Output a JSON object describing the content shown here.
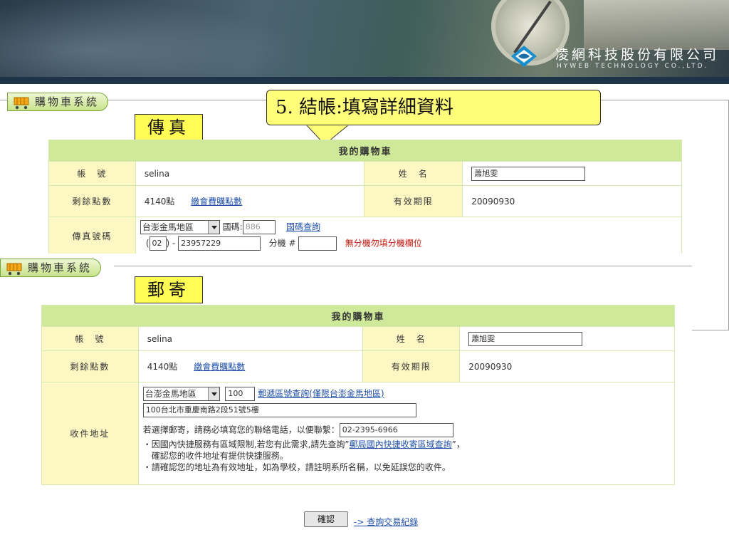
{
  "header": {
    "company_cn": "凌網科技股份有限公司",
    "company_en": "HYWEB TECHNOLOGY CO.,LTD."
  },
  "callout": {
    "text": "5. 結帳:填寫詳細資料"
  },
  "fax_panel": {
    "tab_label": "購物車系統",
    "section_label": "傳真",
    "table_title": "我的購物車",
    "account_label": "帳　號",
    "account_value": "selina",
    "name_label": "姓　名",
    "name_value": "蕭旭雯",
    "points_label": "剩餘點數",
    "points_value": "4140點",
    "pay_link": "繳會費購點數",
    "expiry_label": "有效期限",
    "expiry_value": "20090930",
    "fax_label": "傳真號碼",
    "region_select": "台澎金馬地區",
    "country_code_label": "國碼:",
    "country_code_value": "886",
    "country_lookup_link": "國碼查詢",
    "area_code": "02",
    "fax_number": "23957229",
    "ext_label": "分機 #",
    "ext_note": "無分機勿填分機欄位"
  },
  "mail_panel": {
    "tab_label": "購物車系統",
    "section_label": "郵寄",
    "table_title": "我的購物車",
    "account_label": "帳　號",
    "account_value": "selina",
    "name_label": "姓　名",
    "name_value": "蕭旭雯",
    "points_label": "剩餘點數",
    "points_value": "4140點",
    "pay_link": "繳會費購點數",
    "expiry_label": "有效期限",
    "expiry_value": "20090930",
    "address_label": "收件地址",
    "region_select": "台澎金馬地區",
    "zip_value": "100",
    "zip_lookup_link": "郵遞區號查詢(僅限台澎金馬地區)",
    "address_value": "100台北市重慶南路2段51號5樓",
    "phone_prompt": "若選擇郵寄，請務必填寫您的聯絡電話，以便聯繫：",
    "phone_value": "02-2395-6966",
    "note1_prefix": "・因國內快捷服務有區域限制,若您有此需求,請先查詢”",
    "note1_link": "郵局國內快捷收寄區域查詢",
    "note1_suffix": "”，",
    "note2": "確認您的收件地址有提供快捷服務。",
    "note3": "・請確認您的地址為有效地址，如為學校，請註明系所名稱，以免延誤您的收件。"
  },
  "actions": {
    "confirm_label": "確認",
    "query_link": "-> 查詢交易紀錄"
  }
}
